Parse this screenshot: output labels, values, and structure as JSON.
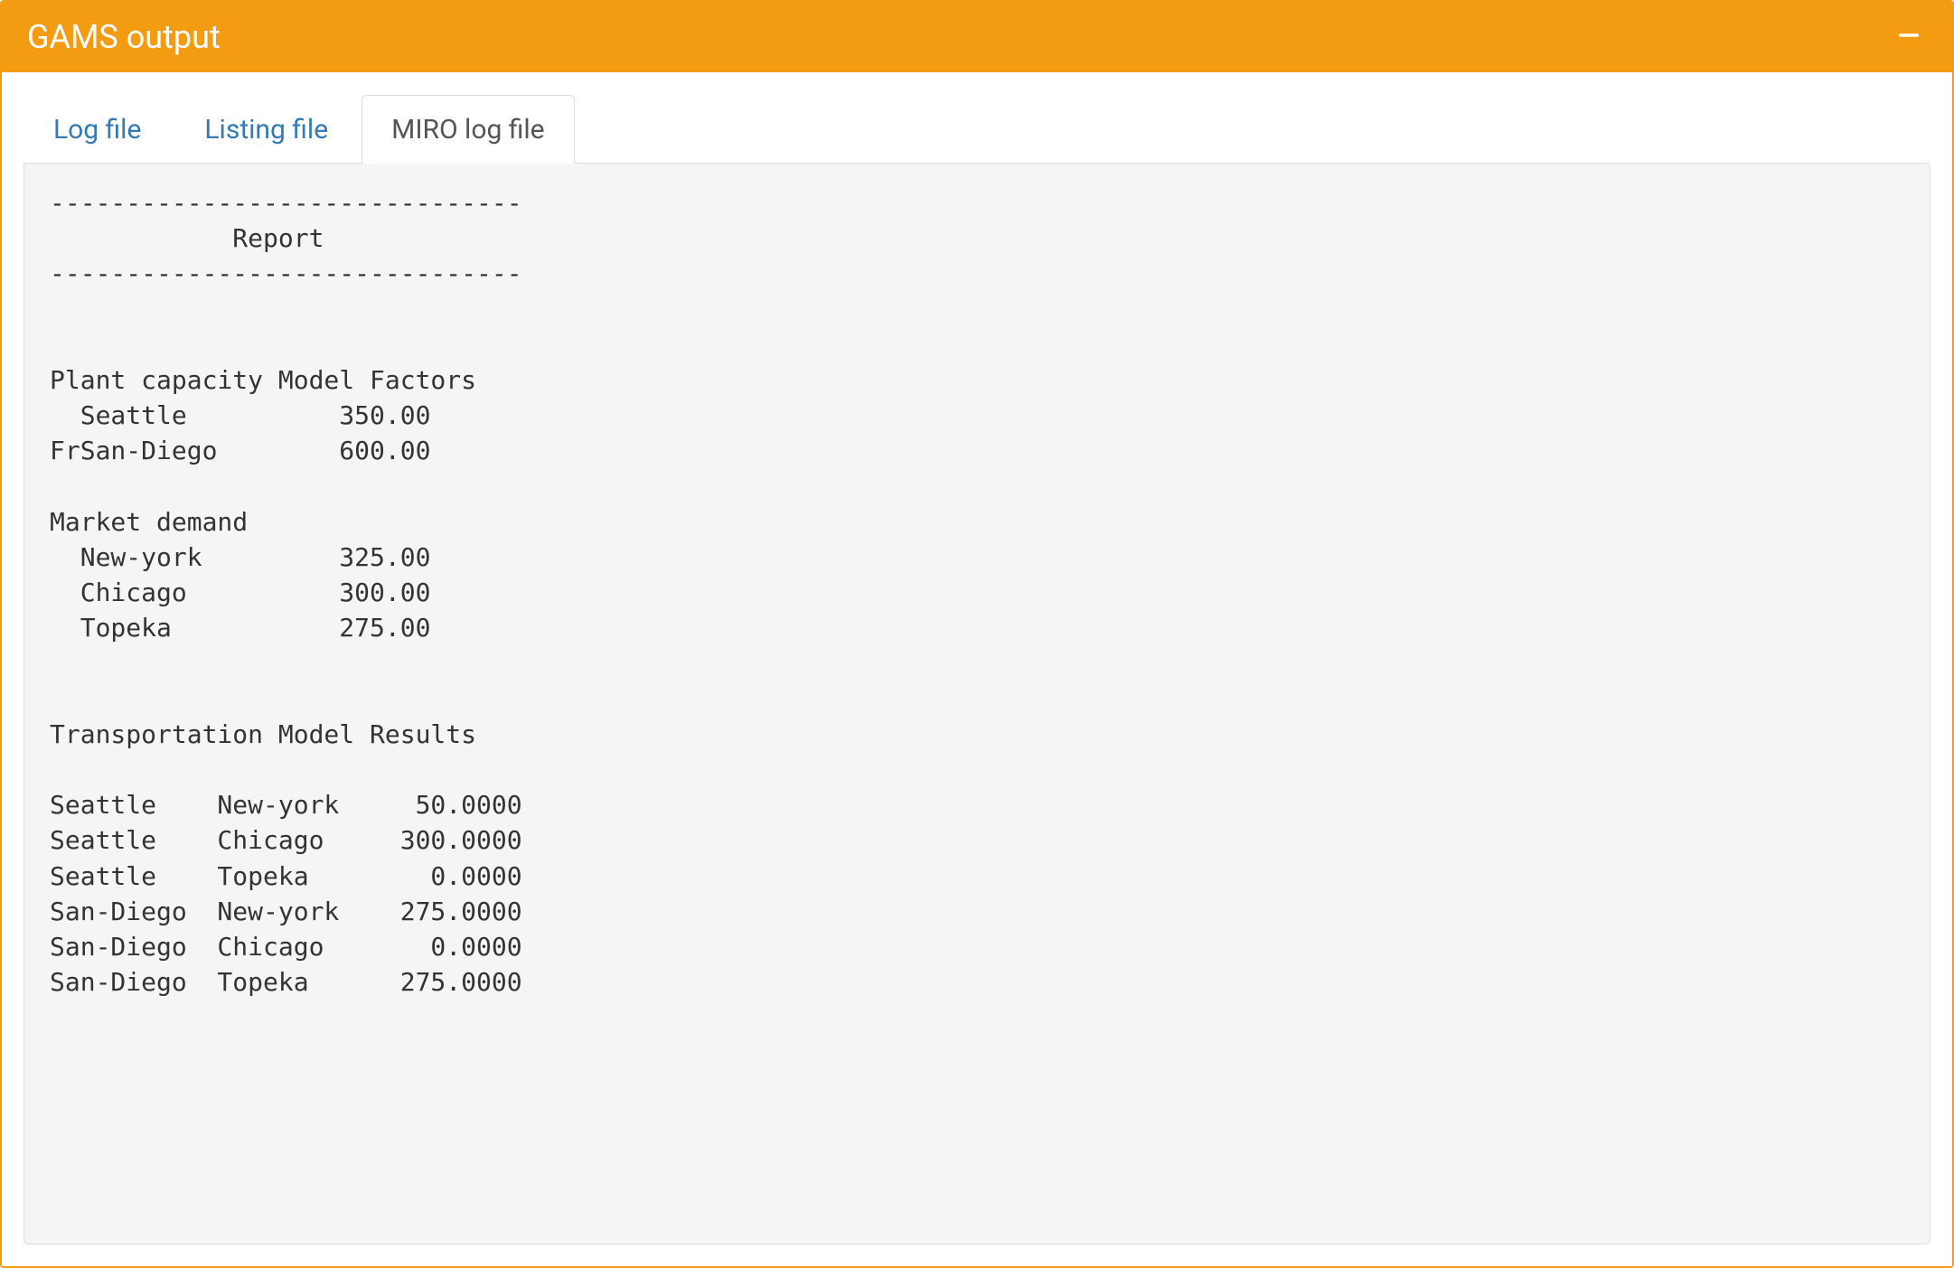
{
  "header": {
    "title": "GAMS output"
  },
  "tabs": {
    "log_file": "Log file",
    "listing_file": "Listing file",
    "miro_log_file": "MIRO log file",
    "active": "miro_log_file"
  },
  "log": {
    "divider": "-------------------------------",
    "report_title": "            Report",
    "section_capacity": "Plant capacity Model Factors",
    "capacity_rows": [
      "  Seattle          350.00",
      "FrSan-Diego        600.00"
    ],
    "section_demand": "Market demand",
    "demand_rows": [
      "  New-york         325.00",
      "  Chicago          300.00",
      "  Topeka           275.00"
    ],
    "section_results": "Transportation Model Results",
    "result_rows": [
      "Seattle    New-york     50.0000",
      "Seattle    Chicago     300.0000",
      "Seattle    Topeka        0.0000",
      "San-Diego  New-york    275.0000",
      "San-Diego  Chicago       0.0000",
      "San-Diego  Topeka      275.0000"
    ]
  }
}
